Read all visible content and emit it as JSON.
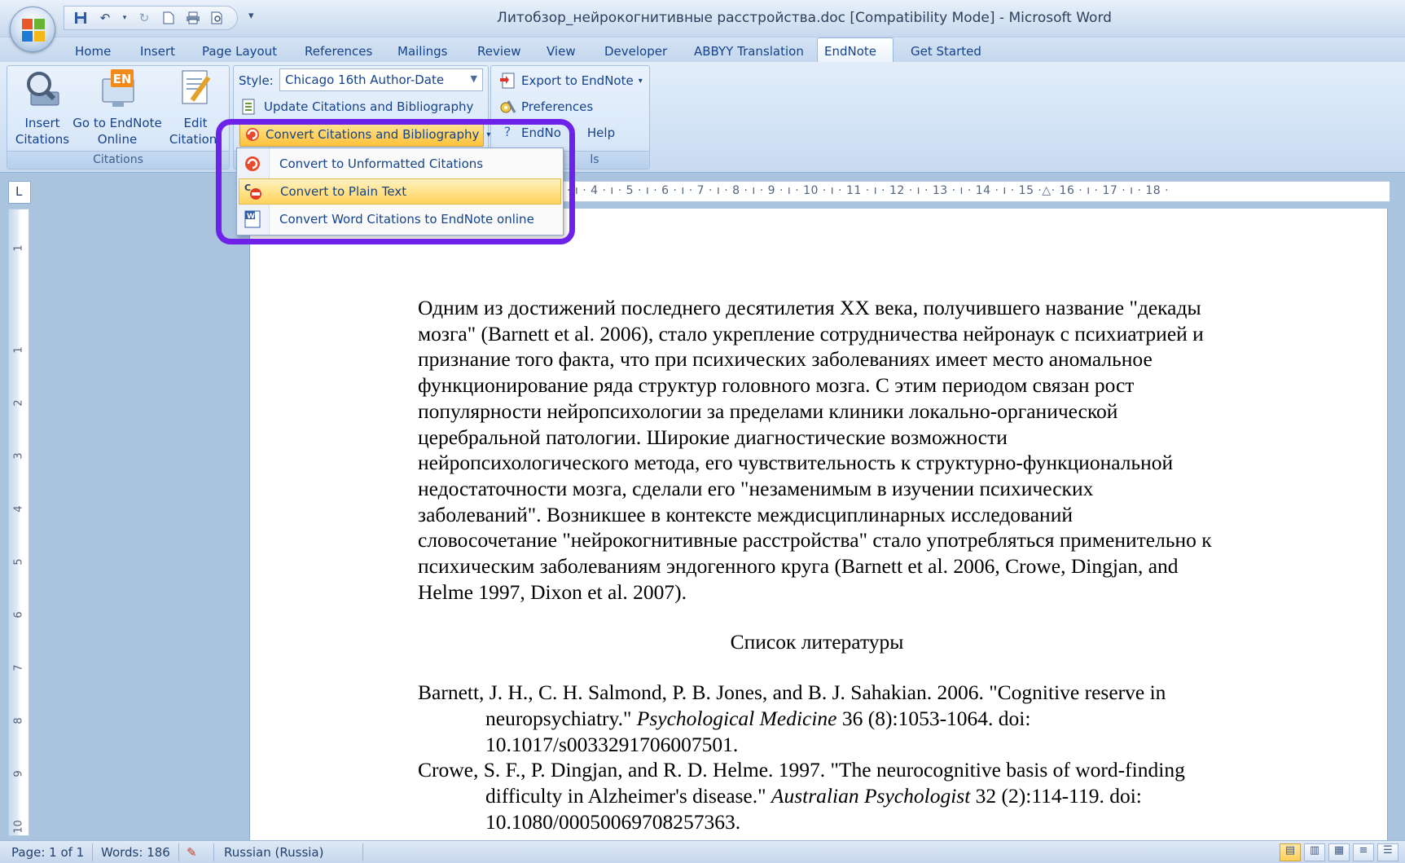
{
  "window": {
    "title": "Литобзор_нейрокогнитивные расстройства.doc [Compatibility Mode] - Microsoft Word"
  },
  "quick_access": [
    "save-icon",
    "undo-icon",
    "redo-icon",
    "new-icon",
    "print-icon",
    "print-preview-icon"
  ],
  "tabs": [
    "Home",
    "Insert",
    "Page Layout",
    "References",
    "Mailings",
    "Review",
    "View",
    "Developer",
    "ABBYY Translation",
    "EndNote",
    "Get Started"
  ],
  "active_tab": "EndNote",
  "ribbon": {
    "citations_group": {
      "label": "Citations",
      "insert_citations": [
        "Insert",
        "Citations"
      ],
      "go_to_endnote_online": [
        "Go to EndNote",
        "Online"
      ],
      "edit_citations": [
        "Edit",
        "Citation("
      ],
      "en_badge": "EN"
    },
    "bibliography_group": {
      "style_label": "Style:",
      "style_value": "Chicago 16th Author-Date",
      "update_citations": "Update Citations and Bibliography",
      "convert_citations": "Convert Citations and Bibliography"
    },
    "tools_group": {
      "label": "ls",
      "export": "Export to EndNote",
      "preferences": "Preferences",
      "help_left": "EndNo",
      "help_right": "Help"
    }
  },
  "dropdown": {
    "items": [
      {
        "label": "Convert to Unformatted Citations",
        "highlighted": false
      },
      {
        "label": "Convert to Plain Text",
        "highlighted": true
      },
      {
        "label": "Convert Word Citations to EndNote online",
        "highlighted": false
      }
    ]
  },
  "ruler": {
    "corner": "L",
    "horizontal": "· ı · 4 · ı · 5 · ı · 6 · ı · 7 · ı · 8 · ı · 9 · ı · 10 · ı · 11 · ı · 12 · ı · 13 · ı · 14 · ı · 15 ·△· 16 · ı · 17 · ı · 18 ·",
    "vertical": [
      "1",
      "1",
      "2",
      "3",
      "4",
      "5",
      "6",
      "7",
      "8",
      "9",
      "10"
    ]
  },
  "document": {
    "paragraph": "Одним из достижений последнего десятилетия XX века, получившего название \"декады мозга\" (Barnett et al. 2006), стало укрепление сотрудничества нейронаук с психиатрией и признание того факта, что при психических заболеваниях имеет место аномальное функционирование ряда структур головного мозга. С этим периодом связан рост популярности нейропсихологии за пределами клиники локально-органической церебральной патологии. Широкие диагностические возможности нейропсихологического метода, его чувствительность к структурно-функциональной недостаточности мозга, сделали его \"незаменимым в изучении психических заболеваний\". Возникшее в контексте междисциплинарных исследований словосочетание \"нейрокогнитивные расстройства\" стало употребляться применительно к психическим заболеваниям эндогенного круга (Barnett et al. 2006, Crowe, Dingjan, and Helme 1997, Dixon et al. 2007).",
    "heading": "Список литературы",
    "references": [
      {
        "before": "Barnett, J. H., C. H. Salmond, P. B. Jones, and B. J. Sahakian. 2006. \"Cognitive reserve in neuropsychiatry.\" ",
        "journal": "Psychological Medicine",
        "after": " 36 (8):1053-1064. doi: 10.1017/s0033291706007501."
      },
      {
        "before": "Crowe, S. F., P. Dingjan, and R. D. Helme. 1997. \"The neurocognitive basis of word-finding difficulty in Alzheimer's disease.\" ",
        "journal": "Australian Psychologist",
        "after": " 32 (2):114-119. doi: 10.1080/00050069708257363."
      }
    ]
  },
  "statusbar": {
    "page": "Page: 1 of 1",
    "words": "Words: 186",
    "language": "Russian (Russia)"
  },
  "colors": {
    "highlight_ring": "#6e21e8",
    "ribbon_text": "#15428b",
    "hover_yellow": "#ffd45e"
  }
}
